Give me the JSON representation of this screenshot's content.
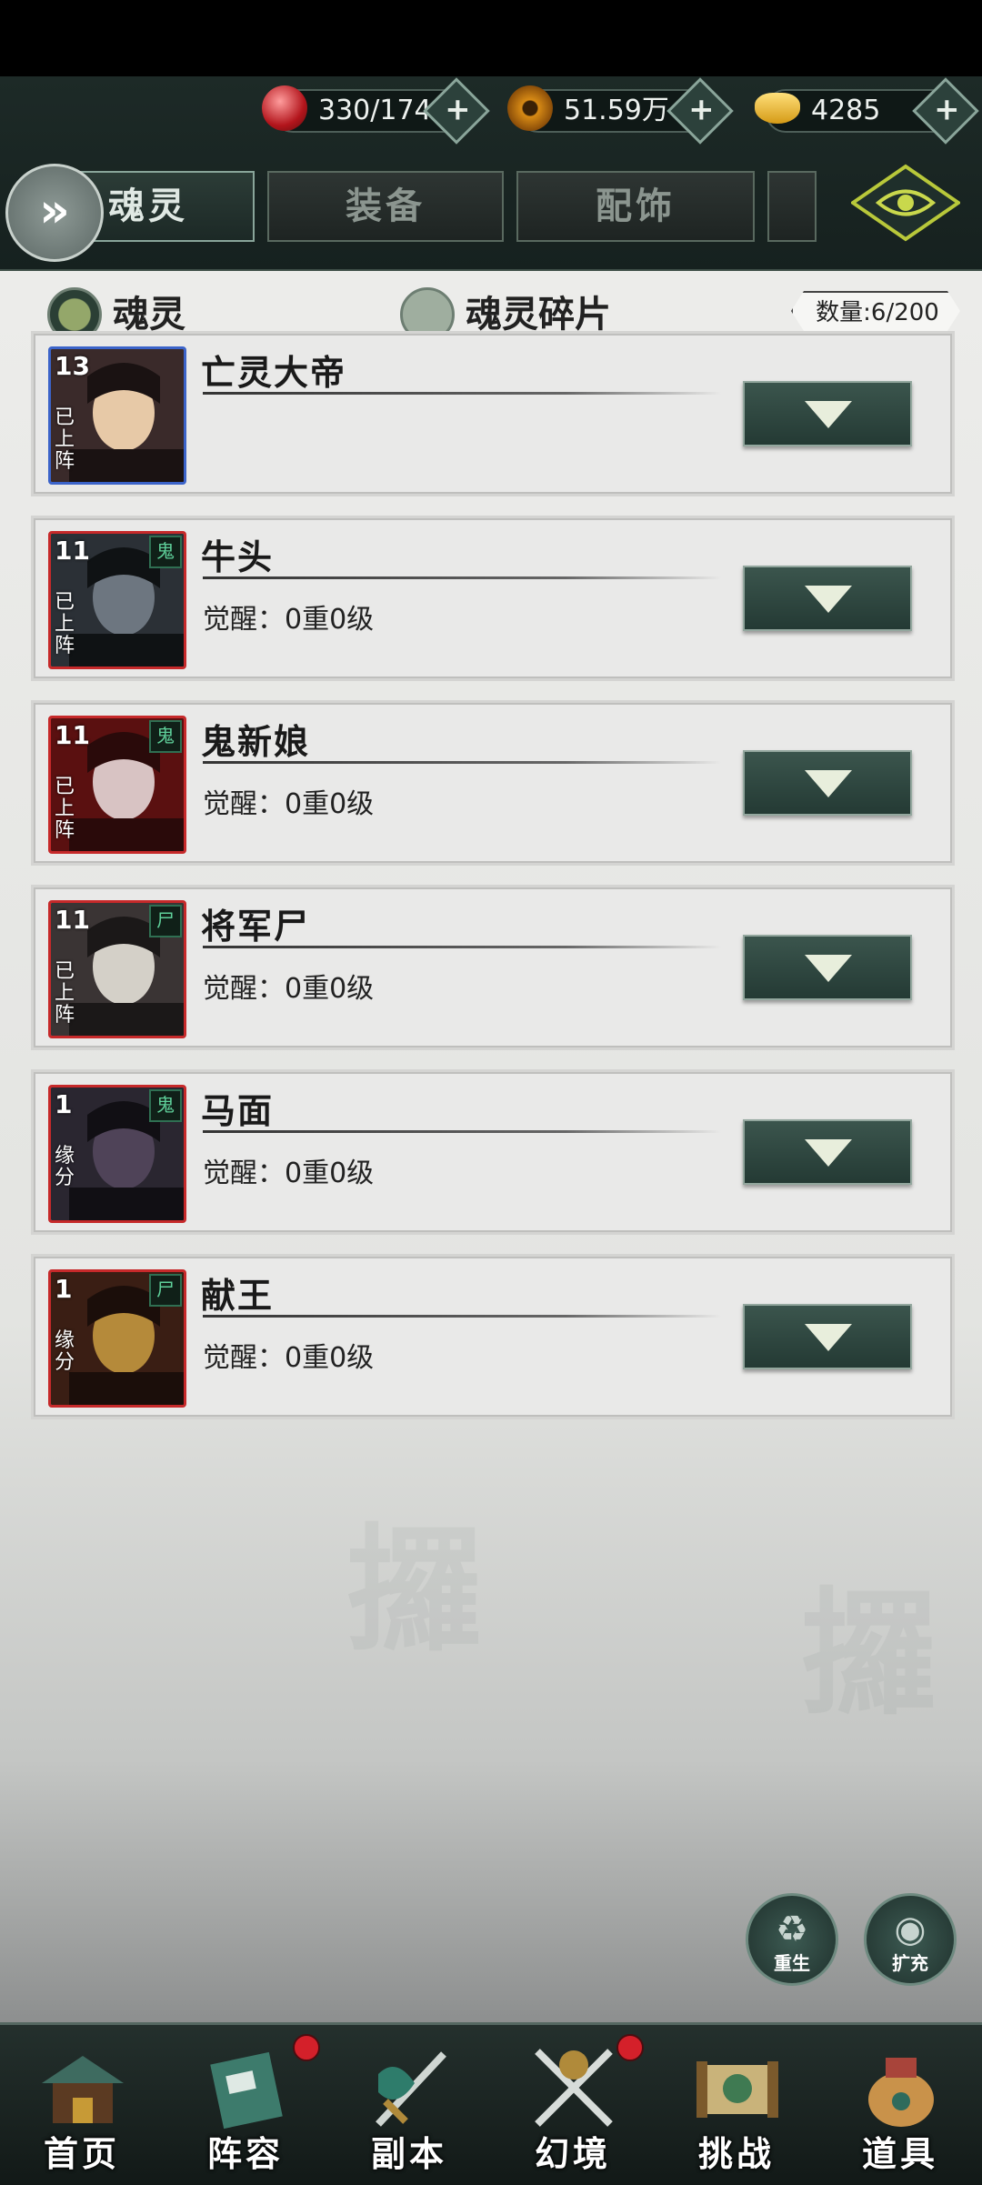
{
  "resources": [
    {
      "icon": "red-orb-icon",
      "value": "330/174"
    },
    {
      "icon": "copper-coin-icon",
      "value": "51.59万"
    },
    {
      "icon": "gold-ingot-icon",
      "value": "4285"
    }
  ],
  "tabs": {
    "soul": "魂灵",
    "equipment": "装备",
    "accessory": "配饰"
  },
  "filters": {
    "soul": "魂灵",
    "shards": "魂灵碎片"
  },
  "count": "数量:6/200",
  "souls": [
    {
      "name": "亡灵大帝",
      "level": "13",
      "tag": "已上阵",
      "awaken": "",
      "frame": "blue",
      "badge": ""
    },
    {
      "name": "牛头",
      "level": "11",
      "tag": "已上阵",
      "awaken": "觉醒：0重0级",
      "frame": "red",
      "badge": "鬼"
    },
    {
      "name": "鬼新娘",
      "level": "11",
      "tag": "已上阵",
      "awaken": "觉醒：0重0级",
      "frame": "red",
      "badge": "鬼"
    },
    {
      "name": "将军尸",
      "level": "11",
      "tag": "已上阵",
      "awaken": "觉醒：0重0级",
      "frame": "red",
      "badge": "尸"
    },
    {
      "name": "马面",
      "level": "1",
      "tag": "缘分",
      "awaken": "觉醒：0重0级",
      "frame": "red",
      "badge": "鬼"
    },
    {
      "name": "献王",
      "level": "1",
      "tag": "缘分",
      "awaken": "觉醒：0重0级",
      "frame": "red",
      "badge": "尸"
    }
  ],
  "actions": {
    "rebirth": "重生",
    "expand": "扩充"
  },
  "nav": [
    {
      "label": "首页",
      "badge": false
    },
    {
      "label": "阵容",
      "badge": true
    },
    {
      "label": "副本",
      "badge": false
    },
    {
      "label": "幻境",
      "badge": true
    },
    {
      "label": "挑战",
      "badge": false
    },
    {
      "label": "道具",
      "badge": false
    }
  ],
  "colors": {
    "accent": "#2f4a43",
    "frame_red": "#c6292a",
    "frame_blue": "#3b63c9",
    "notify": "#d4202a"
  }
}
